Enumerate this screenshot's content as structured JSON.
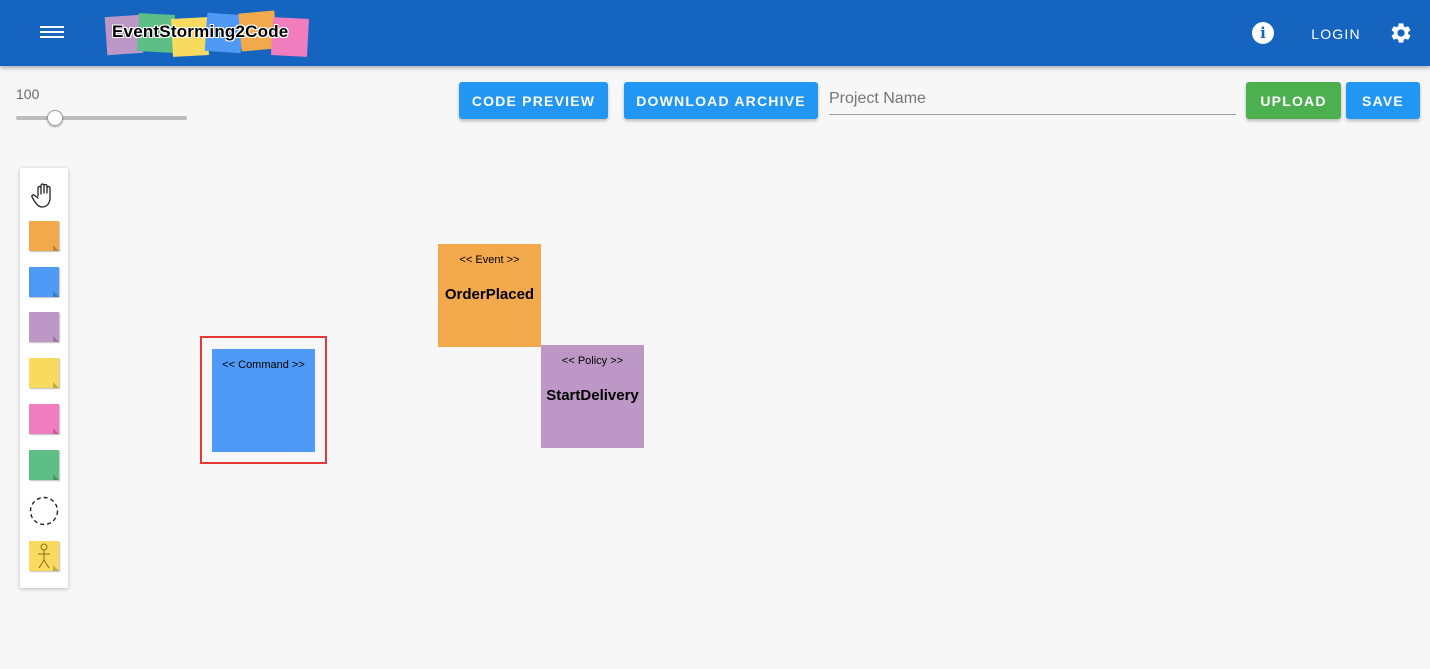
{
  "app": {
    "logo_text": "EventStorming2Code",
    "login_label": "LOGIN",
    "icons": {
      "menu": "menu-icon",
      "info": "info-icon",
      "settings": "gear-icon"
    }
  },
  "toolbar": {
    "zoom_value": "100",
    "zoom_level_fraction": 0.2,
    "code_preview_label": "CODE PREVIEW",
    "download_archive_label": "DOWNLOAD ARCHIVE",
    "project_name_placeholder": "Project Name",
    "project_name_value": "",
    "upload_label": "UPLOAD",
    "save_label": "SAVE"
  },
  "palette": {
    "tools": [
      {
        "name": "hand-tool",
        "icon": "hand-icon"
      },
      {
        "name": "event-sticky",
        "color": "#f2a94b"
      },
      {
        "name": "command-sticky",
        "color": "#4f9af7"
      },
      {
        "name": "policy-sticky",
        "color": "#bd98c6"
      },
      {
        "name": "read-model-sticky",
        "color": "#f8db5e"
      },
      {
        "name": "external-system-sticky",
        "color": "#f07ebf"
      },
      {
        "name": "aggregate-sticky",
        "color": "#5ebf86"
      },
      {
        "name": "bounded-context",
        "icon": "dashed-circle-icon"
      },
      {
        "name": "actor-sticky",
        "color": "#f8db5e",
        "icon": "stick-figure-icon"
      }
    ]
  },
  "canvas": {
    "notes": [
      {
        "stereotype": "<< Command >>",
        "name": "",
        "color": "#4f9af7",
        "selected": true
      },
      {
        "stereotype": "<< Event >>",
        "name": "OrderPlaced",
        "color": "#f2a94b",
        "selected": false
      },
      {
        "stereotype": "<< Policy >>",
        "name": "StartDelivery",
        "color": "#bd98c6",
        "selected": false
      }
    ]
  },
  "colors": {
    "appbar": "#1565c0",
    "primary_button": "#2196f3",
    "upload_button": "#4caf50",
    "selection": "#e53935"
  }
}
